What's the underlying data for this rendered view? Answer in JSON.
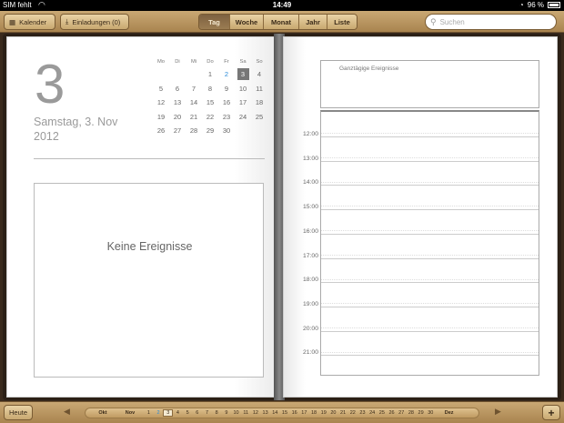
{
  "status": {
    "carrier": "SIM fehlt",
    "time": "14:49",
    "battery": "96 %",
    "battery_level": 0.96
  },
  "toolbar": {
    "calendars_label": "Kalender",
    "invitations_label": "Einladungen (0)",
    "views": [
      "Tag",
      "Woche",
      "Monat",
      "Jahr",
      "Liste"
    ],
    "active_view": "Tag",
    "search_placeholder": "Suchen"
  },
  "day": {
    "number": "3",
    "weekday_date": "Samstag, 3. Nov",
    "year": "2012",
    "empty_text": "Keine Ereignisse"
  },
  "minical": {
    "weekdays": [
      "Mo",
      "Di",
      "Mi",
      "Do",
      "Fr",
      "Sa",
      "So"
    ],
    "weeks": [
      [
        "",
        "",
        "",
        "1",
        "2",
        "3",
        "4"
      ],
      [
        "5",
        "6",
        "7",
        "8",
        "9",
        "10",
        "11"
      ],
      [
        "12",
        "13",
        "14",
        "15",
        "16",
        "17",
        "18"
      ],
      [
        "19",
        "20",
        "21",
        "22",
        "23",
        "24",
        "25"
      ],
      [
        "26",
        "27",
        "28",
        "29",
        "30",
        "",
        ""
      ]
    ],
    "selected": "3",
    "today": "2"
  },
  "schedule": {
    "allday_label": "Ganztägige Ereignisse",
    "hours": [
      "12:00",
      "13:00",
      "14:00",
      "15:00",
      "16:00",
      "17:00",
      "18:00",
      "19:00",
      "20:00",
      "21:00"
    ]
  },
  "bottom": {
    "today_label": "Heute",
    "add_label": "+",
    "prev_month": "Okt",
    "current_month": "Nov",
    "next_month": "Dez",
    "days": [
      "1",
      "2",
      "3",
      "4",
      "5",
      "6",
      "7",
      "8",
      "9",
      "10",
      "11",
      "12",
      "13",
      "14",
      "15",
      "16",
      "17",
      "18",
      "19",
      "20",
      "21",
      "22",
      "23",
      "24",
      "25",
      "26",
      "27",
      "28",
      "29",
      "30"
    ],
    "selected_day": "3",
    "today_day": "2"
  }
}
